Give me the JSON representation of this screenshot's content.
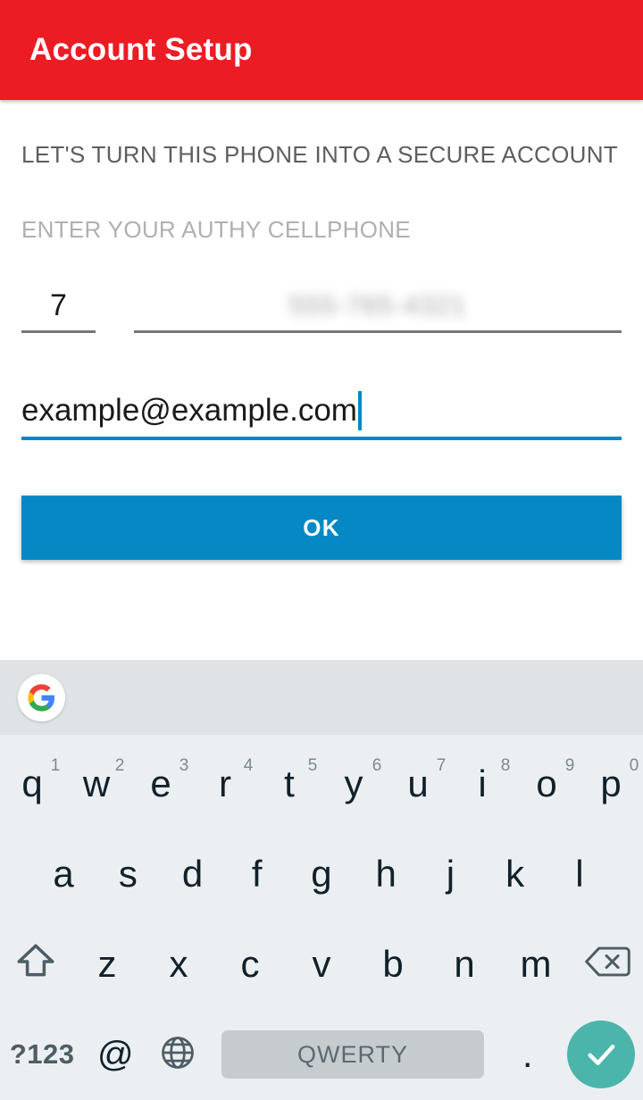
{
  "appbar": {
    "title": "Account Setup",
    "background": "#EC1C24",
    "title_color": "#FFFFFF"
  },
  "form": {
    "headline": "LET'S TURN THIS PHONE INTO A SECURE ACCOUNT",
    "subhead": "ENTER YOUR AUTHY CELLPHONE",
    "country_code": {
      "value": "7",
      "name": "country-code"
    },
    "phone": {
      "value": "555-765-4321",
      "redacted": true
    },
    "email": {
      "value": "example@example.com",
      "focused": true,
      "accent": "#0588C4"
    },
    "ok_button": {
      "label": "OK",
      "background": "#0588C4",
      "text_color": "#FFFFFF"
    }
  },
  "keyboard": {
    "strip": {
      "logo": "google-g-logo",
      "background": "#E0E3E5"
    },
    "background": "#ECEFF1",
    "row1": [
      {
        "key": "q",
        "sup": "1"
      },
      {
        "key": "w",
        "sup": "2"
      },
      {
        "key": "e",
        "sup": "3"
      },
      {
        "key": "r",
        "sup": "4"
      },
      {
        "key": "t",
        "sup": "5"
      },
      {
        "key": "y",
        "sup": "6"
      },
      {
        "key": "u",
        "sup": "7"
      },
      {
        "key": "i",
        "sup": "8"
      },
      {
        "key": "o",
        "sup": "9"
      },
      {
        "key": "p",
        "sup": "0"
      }
    ],
    "row2": [
      {
        "key": "a"
      },
      {
        "key": "s"
      },
      {
        "key": "d"
      },
      {
        "key": "f"
      },
      {
        "key": "g"
      },
      {
        "key": "h"
      },
      {
        "key": "j"
      },
      {
        "key": "k"
      },
      {
        "key": "l"
      }
    ],
    "row3": [
      {
        "key": "z"
      },
      {
        "key": "x"
      },
      {
        "key": "c"
      },
      {
        "key": "v"
      },
      {
        "key": "b"
      },
      {
        "key": "n"
      },
      {
        "key": "m"
      }
    ],
    "shift": "shift-icon",
    "backspace": "backspace-icon",
    "row4": {
      "symbols_label": "?123",
      "at_label": "@",
      "globe": "globe-icon",
      "space_label": "QWERTY",
      "period_label": ".",
      "enter": "checkmark-icon",
      "enter_background": "#4BB5AB"
    }
  }
}
